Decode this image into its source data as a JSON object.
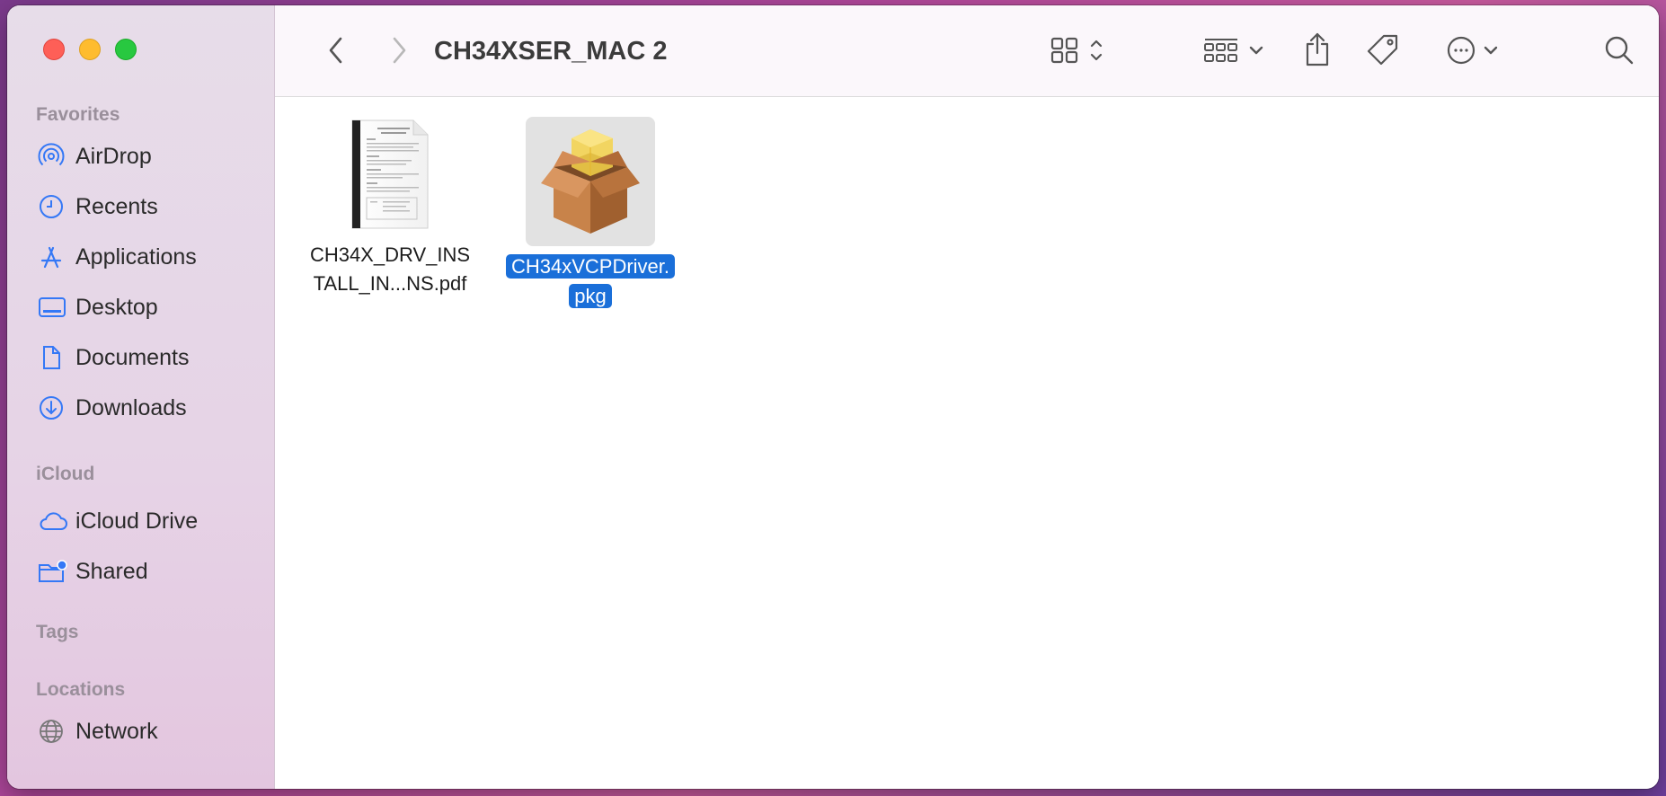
{
  "window": {
    "title": "CH34XSER_MAC 2"
  },
  "sidebar": {
    "favorites_title": "Favorites",
    "favorites": [
      {
        "label": "AirDrop",
        "icon": "airdrop-icon"
      },
      {
        "label": "Recents",
        "icon": "clock-icon"
      },
      {
        "label": "Applications",
        "icon": "applications-icon"
      },
      {
        "label": "Desktop",
        "icon": "desktop-icon"
      },
      {
        "label": "Documents",
        "icon": "document-icon"
      },
      {
        "label": "Downloads",
        "icon": "download-icon"
      }
    ],
    "icloud_title": "iCloud",
    "icloud": [
      {
        "label": "iCloud Drive",
        "icon": "cloud-icon"
      },
      {
        "label": "Shared",
        "icon": "shared-folder-icon"
      }
    ],
    "tags_title": "Tags",
    "locations_title": "Locations",
    "locations": [
      {
        "label": "Network",
        "icon": "globe-icon"
      }
    ]
  },
  "files": [
    {
      "line1": "CH34X_DRV_INS",
      "line2": "TALL_IN...NS.pdf",
      "icon": "pdf-document-icon",
      "selected": false
    },
    {
      "line1": "CH34xVCPDriver.",
      "line2": "pkg",
      "icon": "package-icon",
      "selected": true
    }
  ],
  "colors": {
    "accent": "#1a6fd9",
    "sidebar_icon": "#3478f6"
  }
}
